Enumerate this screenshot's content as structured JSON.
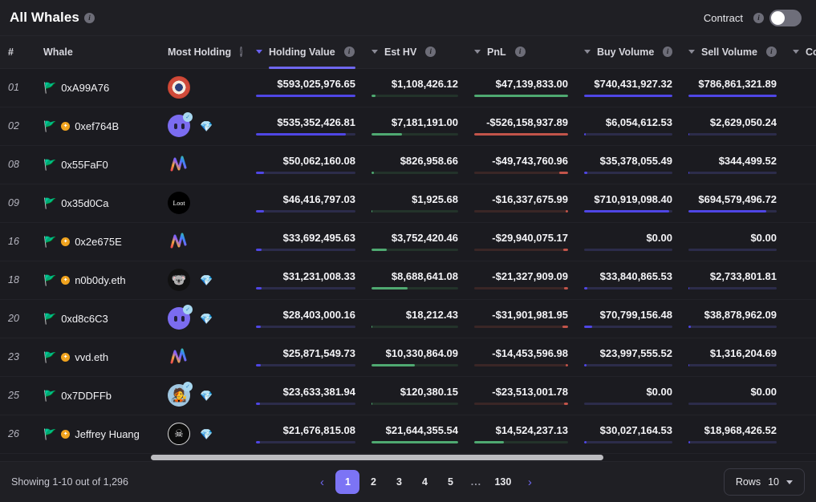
{
  "header": {
    "title": "All Whales",
    "title_info_icon": "info-icon",
    "contract_label": "Contract",
    "contract_info_icon": "info-icon",
    "contract_toggle_on": false
  },
  "columns": [
    {
      "key": "rank",
      "label": "#",
      "info": false,
      "sortable": false,
      "active": false,
      "align": "left"
    },
    {
      "key": "whale",
      "label": "Whale",
      "info": false,
      "sortable": false,
      "active": false,
      "align": "left"
    },
    {
      "key": "most",
      "label": "Most Holding",
      "info": true,
      "sortable": false,
      "active": false,
      "align": "left"
    },
    {
      "key": "hv",
      "label": "Holding Value",
      "info": true,
      "sortable": true,
      "active": true,
      "align": "right"
    },
    {
      "key": "esthv",
      "label": "Est HV",
      "info": true,
      "sortable": true,
      "active": false,
      "align": "right"
    },
    {
      "key": "pnl",
      "label": "PnL",
      "info": true,
      "sortable": true,
      "active": false,
      "align": "right"
    },
    {
      "key": "buy",
      "label": "Buy Volume",
      "info": true,
      "sortable": true,
      "active": false,
      "align": "right"
    },
    {
      "key": "sell",
      "label": "Sell Volume",
      "info": true,
      "sortable": true,
      "active": false,
      "align": "right"
    },
    {
      "key": "coll",
      "label": "Collec",
      "info": false,
      "sortable": true,
      "active": false,
      "align": "right"
    }
  ],
  "rows": [
    {
      "rank": "01",
      "name": "0xA99A76",
      "flag": "flag-icon",
      "badge": false,
      "avatar": "azuki-avatar",
      "verified": false,
      "gem": false,
      "hv": {
        "text": "$593,025,976.65",
        "pct": 100,
        "color": "blue"
      },
      "esthv": {
        "text": "$1,108,426.12",
        "pct": 5,
        "color": "green"
      },
      "pnl": {
        "text": "$47,139,833.00",
        "pct": 100,
        "color": "green"
      },
      "buy": {
        "text": "$740,431,927.32",
        "pct": 100,
        "color": "blue"
      },
      "sell": {
        "text": "$786,861,321.89",
        "pct": 100,
        "color": "blue"
      }
    },
    {
      "rank": "02",
      "name": "0xef764B",
      "flag": "flag-icon",
      "badge": true,
      "avatar": "blur-avatar",
      "verified": true,
      "gem": true,
      "hv": {
        "text": "$535,352,426.81",
        "pct": 90,
        "color": "blue"
      },
      "esthv": {
        "text": "$7,181,191.00",
        "pct": 35,
        "color": "green"
      },
      "pnl": {
        "text": "-$526,158,937.89",
        "pct": 100,
        "color": "red"
      },
      "buy": {
        "text": "$6,054,612.53",
        "pct": 2,
        "color": "blue"
      },
      "sell": {
        "text": "$2,629,050.24",
        "pct": 1,
        "color": "blue"
      }
    },
    {
      "rank": "08",
      "name": "0x55FaF0",
      "flag": "flag-icon",
      "badge": false,
      "avatar": "rainbow-avatar",
      "verified": false,
      "gem": false,
      "hv": {
        "text": "$50,062,160.08",
        "pct": 8,
        "color": "blue"
      },
      "esthv": {
        "text": "$826,958.66",
        "pct": 3,
        "color": "green"
      },
      "pnl": {
        "text": "-$49,743,760.96",
        "pct": 9,
        "color": "red"
      },
      "buy": {
        "text": "$35,378,055.49",
        "pct": 4,
        "color": "blue"
      },
      "sell": {
        "text": "$344,499.52",
        "pct": 1,
        "color": "blue"
      }
    },
    {
      "rank": "09",
      "name": "0x35d0Ca",
      "flag": "flag-icon",
      "badge": false,
      "avatar": "loot-avatar",
      "verified": false,
      "gem": false,
      "hv": {
        "text": "$46,416,797.03",
        "pct": 8,
        "color": "blue"
      },
      "esthv": {
        "text": "$1,925.68",
        "pct": 1,
        "color": "green"
      },
      "pnl": {
        "text": "-$16,337,675.99",
        "pct": 3,
        "color": "red"
      },
      "buy": {
        "text": "$710,919,098.40",
        "pct": 96,
        "color": "blue"
      },
      "sell": {
        "text": "$694,579,496.72",
        "pct": 88,
        "color": "blue"
      }
    },
    {
      "rank": "16",
      "name": "0x2e675E",
      "flag": "flag-icon",
      "badge": true,
      "avatar": "rainbow-avatar",
      "verified": false,
      "gem": false,
      "hv": {
        "text": "$33,692,495.63",
        "pct": 6,
        "color": "blue"
      },
      "esthv": {
        "text": "$3,752,420.46",
        "pct": 18,
        "color": "green"
      },
      "pnl": {
        "text": "-$29,940,075.17",
        "pct": 5,
        "color": "red"
      },
      "buy": {
        "text": "$0.00",
        "pct": 0,
        "color": "blue"
      },
      "sell": {
        "text": "$0.00",
        "pct": 0,
        "color": "blue"
      }
    },
    {
      "rank": "18",
      "name": "n0b0dy.eth",
      "flag": "flag-icon",
      "badge": true,
      "avatar": "koala-avatar",
      "verified": false,
      "gem": true,
      "hv": {
        "text": "$31,231,008.33",
        "pct": 6,
        "color": "blue"
      },
      "esthv": {
        "text": "$8,688,641.08",
        "pct": 42,
        "color": "green"
      },
      "pnl": {
        "text": "-$21,327,909.09",
        "pct": 4,
        "color": "red"
      },
      "buy": {
        "text": "$33,840,865.53",
        "pct": 4,
        "color": "blue"
      },
      "sell": {
        "text": "$2,733,801.81",
        "pct": 1,
        "color": "blue"
      }
    },
    {
      "rank": "20",
      "name": "0xd8c6C3",
      "flag": "flag-icon",
      "badge": false,
      "avatar": "blur-avatar",
      "verified": true,
      "gem": true,
      "hv": {
        "text": "$28,403,000.16",
        "pct": 5,
        "color": "blue"
      },
      "esthv": {
        "text": "$18,212.43",
        "pct": 1,
        "color": "green"
      },
      "pnl": {
        "text": "-$31,901,981.95",
        "pct": 6,
        "color": "red"
      },
      "buy": {
        "text": "$70,799,156.48",
        "pct": 9,
        "color": "blue"
      },
      "sell": {
        "text": "$38,878,962.09",
        "pct": 3,
        "color": "blue"
      }
    },
    {
      "rank": "23",
      "name": "vvd.eth",
      "flag": "flag-icon",
      "badge": true,
      "avatar": "rainbow-avatar",
      "verified": false,
      "gem": false,
      "hv": {
        "text": "$25,871,549.73",
        "pct": 5,
        "color": "blue"
      },
      "esthv": {
        "text": "$10,330,864.09",
        "pct": 50,
        "color": "green"
      },
      "pnl": {
        "text": "-$14,453,596.98",
        "pct": 3,
        "color": "red"
      },
      "buy": {
        "text": "$23,997,555.52",
        "pct": 3,
        "color": "blue"
      },
      "sell": {
        "text": "$1,316,204.69",
        "pct": 1,
        "color": "blue"
      }
    },
    {
      "rank": "25",
      "name": "0x7DDFFb",
      "flag": "flag-icon",
      "badge": false,
      "avatar": "punk-avatar",
      "verified": true,
      "gem": true,
      "hv": {
        "text": "$23,633,381.94",
        "pct": 4,
        "color": "blue"
      },
      "esthv": {
        "text": "$120,380.15",
        "pct": 1,
        "color": "green"
      },
      "pnl": {
        "text": "-$23,513,001.78",
        "pct": 4,
        "color": "red"
      },
      "buy": {
        "text": "$0.00",
        "pct": 0,
        "color": "blue"
      },
      "sell": {
        "text": "$0.00",
        "pct": 0,
        "color": "blue"
      }
    },
    {
      "rank": "26",
      "name": "Jeffrey Huang",
      "flag": "flag-icon",
      "badge": true,
      "avatar": "cgc-avatar",
      "verified": false,
      "gem": true,
      "hv": {
        "text": "$21,676,815.08",
        "pct": 4,
        "color": "blue"
      },
      "esthv": {
        "text": "$21,644,355.54",
        "pct": 100,
        "color": "green"
      },
      "pnl": {
        "text": "$14,524,237.13",
        "pct": 32,
        "color": "green"
      },
      "buy": {
        "text": "$30,027,164.53",
        "pct": 3,
        "color": "blue"
      },
      "sell": {
        "text": "$18,968,426.52",
        "pct": 2,
        "color": "blue"
      }
    }
  ],
  "footer": {
    "showing": "Showing 1-10 out of 1,296",
    "prev_label": "‹",
    "next_label": "›",
    "pages": [
      "1",
      "2",
      "3",
      "4",
      "5",
      "...",
      "130"
    ],
    "current_page": "1",
    "rows_label": "Rows",
    "rows_value": "10"
  },
  "colors": {
    "accent": "#6f67ef",
    "positive": "#4fa971",
    "negative": "#c2544a",
    "bar_blue": "#4f46e5",
    "page_active": "#7c74f5"
  }
}
